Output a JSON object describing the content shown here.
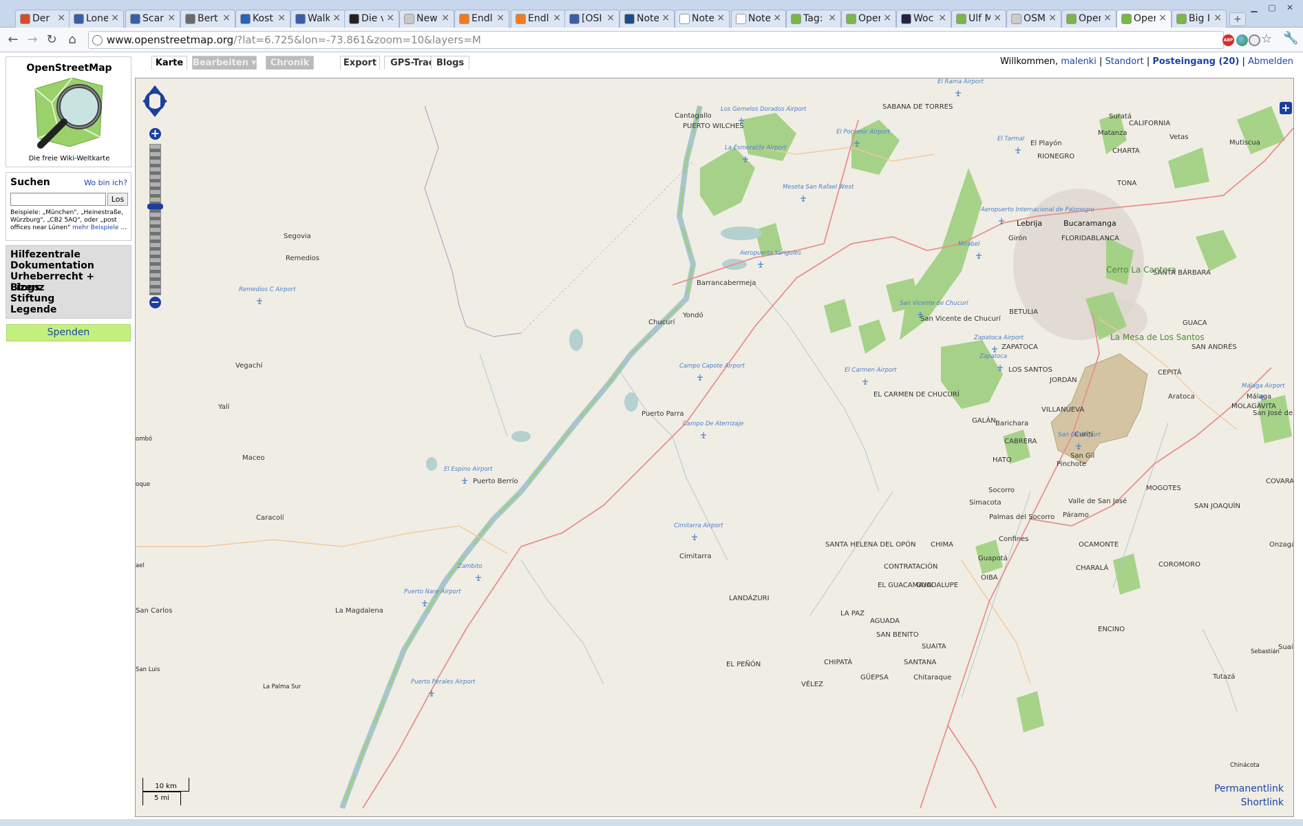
{
  "browser": {
    "tabs": [
      {
        "title": "Der",
        "fav": "#d94a2a"
      },
      {
        "title": "Lone",
        "fav": "#3b5ea8"
      },
      {
        "title": "Scar",
        "fav": "#3b5ea8"
      },
      {
        "title": "Bert",
        "fav": "#6b6b6b"
      },
      {
        "title": "Kost",
        "fav": "#2a62b8"
      },
      {
        "title": "Walk",
        "fav": "#3b5ea8"
      },
      {
        "title": "Die v",
        "fav": "#222222"
      },
      {
        "title": "New",
        "fav": "#c8c8c8"
      },
      {
        "title": "Endl",
        "fav": "#f37b1d"
      },
      {
        "title": "Endl",
        "fav": "#f37b1d"
      },
      {
        "title": "[OSI",
        "fav": "#3b5ea8"
      },
      {
        "title": "Note",
        "fav": "#1b4d8c"
      },
      {
        "title": "Note",
        "fav": "#ffffff"
      },
      {
        "title": "Note",
        "fav": "#ffffff"
      },
      {
        "title": "Tag:",
        "fav": "#7ab648"
      },
      {
        "title": "Oper",
        "fav": "#7ab648"
      },
      {
        "title": "Woc",
        "fav": "#222244"
      },
      {
        "title": "Ulf M",
        "fav": "#7ab648"
      },
      {
        "title": "OSM",
        "fav": "#cccccc"
      },
      {
        "title": "Oper",
        "fav": "#7ab648"
      },
      {
        "title": "Oper",
        "fav": "#7ab648"
      },
      {
        "title": "Big I",
        "fav": "#7ab648"
      }
    ],
    "active_tab": 20,
    "url_host": "www.openstreetmap.org",
    "url_rest": "/?lat=6.725&lon=-73.861&zoom=10&layers=M",
    "ext_abp": "ABP"
  },
  "sidebar": {
    "logo_title": "OpenStreetMap",
    "logo_subtitle": "Die freie Wiki-Weltkarte",
    "search_title": "Suchen",
    "where_am_i": "Wo bin ich?",
    "search_value": "",
    "search_button": "Los",
    "search_hint": "Beispiele: „München\", „Heinestraße, Würzburg\", „CB2 5AQ\", oder „post offices near Lünen\"",
    "search_more": "mehr Beispiele",
    "search_ellipsis": "…",
    "menu": [
      "Hilfezentrale",
      "Dokumentation",
      "Urheberrecht + Lizenz",
      "Blogs",
      "Stiftung",
      "Legende"
    ],
    "donate": "Spenden"
  },
  "page_tabs": [
    "Karte",
    "Bearbeiten ▾",
    "Chronik",
    "Export",
    "GPS-Tracks",
    "Blogs"
  ],
  "userbar": {
    "welcome": "Willkommen, ",
    "user": "malenki",
    "sep1": " | ",
    "location": "Standort",
    "sep2": " | ",
    "inbox": "Posteingang (20)",
    "sep3": " | ",
    "logout": "Abmelden"
  },
  "map": {
    "permalink": "Permanentlink",
    "shortlink": "Shortlink",
    "scale_km": "10 km",
    "scale_mi": "5 mi",
    "colors": {
      "water": "#b5d0d0",
      "forest": "#9ecf7e",
      "road": "#e8908a",
      "border": "#b9a6c2",
      "secondary": "#f3c998"
    },
    "places": [
      {
        "name": "Cantagallo",
        "cls": "med"
      },
      {
        "name": "PUERTO WILCHES",
        "cls": "med"
      },
      {
        "name": "SABANA DE TORRES",
        "cls": "med"
      },
      {
        "name": "Barrancabermeja",
        "cls": "med"
      },
      {
        "name": "Yondó",
        "cls": "med"
      },
      {
        "name": "Segovia",
        "cls": "med"
      },
      {
        "name": "Remedios",
        "cls": "med"
      },
      {
        "name": "Chucurí",
        "cls": "med"
      },
      {
        "name": "Vegachí",
        "cls": "med"
      },
      {
        "name": "Yalí",
        "cls": "med"
      },
      {
        "name": "Maceo",
        "cls": "med"
      },
      {
        "name": "Puerto Berrío",
        "cls": "med"
      },
      {
        "name": "Caracolí",
        "cls": "med"
      },
      {
        "name": "Puerto Parra",
        "cls": "med"
      },
      {
        "name": "Cimitarra",
        "cls": "med"
      },
      {
        "name": "La Magdalena",
        "cls": "med"
      },
      {
        "name": "San Carlos",
        "cls": "med"
      },
      {
        "name": "LANDÁZURI",
        "cls": "med"
      },
      {
        "name": "EL PEÑÓN",
        "cls": "med"
      },
      {
        "name": "SANTA HELENA DEL OPÓN",
        "cls": "med"
      },
      {
        "name": "EL CARMEN DE CHUCURÍ",
        "cls": "med"
      },
      {
        "name": "San Vicente de Chucurí",
        "cls": "med"
      },
      {
        "name": "Bucaramanga",
        "cls": "big"
      },
      {
        "name": "Lebrija",
        "cls": "big"
      },
      {
        "name": "FLORIDABLANCA",
        "cls": "med"
      },
      {
        "name": "Girón",
        "cls": "med"
      },
      {
        "name": "RIONEGRO",
        "cls": "med"
      },
      {
        "name": "El Playón",
        "cls": "med"
      },
      {
        "name": "Matanza",
        "cls": "med"
      },
      {
        "name": "Suratá",
        "cls": "med"
      },
      {
        "name": "CALIFORNIA",
        "cls": "med"
      },
      {
        "name": "Vetas",
        "cls": "med"
      },
      {
        "name": "CHARTA",
        "cls": "med"
      },
      {
        "name": "TONA",
        "cls": "med"
      },
      {
        "name": "Mutiscua",
        "cls": "med"
      },
      {
        "name": "SANTA BÁRBARA",
        "cls": "med"
      },
      {
        "name": "BETULIA",
        "cls": "med"
      },
      {
        "name": "ZAPATOCA",
        "cls": "med"
      },
      {
        "name": "LOS SANTOS",
        "cls": "med"
      },
      {
        "name": "JORDÁN",
        "cls": "med"
      },
      {
        "name": "CEPITÁ",
        "cls": "med"
      },
      {
        "name": "GUACA",
        "cls": "med"
      },
      {
        "name": "SAN ANDRÉS",
        "cls": "med"
      },
      {
        "name": "Aratoca",
        "cls": "med"
      },
      {
        "name": "VILLANUEVA",
        "cls": "med"
      },
      {
        "name": "Barichara",
        "cls": "med"
      },
      {
        "name": "GALÁN",
        "cls": "med"
      },
      {
        "name": "CABRERA",
        "cls": "med"
      },
      {
        "name": "San Gil",
        "cls": "med"
      },
      {
        "name": "Curití",
        "cls": "med"
      },
      {
        "name": "Pinchote",
        "cls": "med"
      },
      {
        "name": "HATO",
        "cls": "med"
      },
      {
        "name": "Socorro",
        "cls": "med"
      },
      {
        "name": "Simacota",
        "cls": "med"
      },
      {
        "name": "Palmas del Socorro",
        "cls": "med"
      },
      {
        "name": "Páramo",
        "cls": "med"
      },
      {
        "name": "Valle de San José",
        "cls": "med"
      },
      {
        "name": "MOGOTES",
        "cls": "med"
      },
      {
        "name": "SAN JOAQUÍN",
        "cls": "med"
      },
      {
        "name": "MOLAGAVITA",
        "cls": "med"
      },
      {
        "name": "Málaga",
        "cls": "med"
      },
      {
        "name": "San José de Miranda",
        "cls": "med"
      },
      {
        "name": "COVARACHÍA",
        "cls": "med"
      },
      {
        "name": "Onzaga",
        "cls": "med"
      },
      {
        "name": "OCAMONTE",
        "cls": "med"
      },
      {
        "name": "CHIMA",
        "cls": "med"
      },
      {
        "name": "Confines",
        "cls": "med"
      },
      {
        "name": "Guapotá",
        "cls": "med"
      },
      {
        "name": "OIBA",
        "cls": "med"
      },
      {
        "name": "CHARALÁ",
        "cls": "med"
      },
      {
        "name": "COROMORO",
        "cls": "med"
      },
      {
        "name": "CONTRATACIÓN",
        "cls": "med"
      },
      {
        "name": "EL GUACAMAYO",
        "cls": "med"
      },
      {
        "name": "GUADALUPE",
        "cls": "med"
      },
      {
        "name": "LA PAZ",
        "cls": "med"
      },
      {
        "name": "AGUADA",
        "cls": "med"
      },
      {
        "name": "SAN BENITO",
        "cls": "med"
      },
      {
        "name": "SUAITA",
        "cls": "med"
      },
      {
        "name": "SANTANA",
        "cls": "med"
      },
      {
        "name": "CHIPATÁ",
        "cls": "med"
      },
      {
        "name": "VÉLEZ",
        "cls": "med"
      },
      {
        "name": "GÜEPSA",
        "cls": "med"
      },
      {
        "name": "Chitaraque",
        "cls": "med"
      },
      {
        "name": "ENCINO",
        "cls": "med"
      },
      {
        "name": "Tutazá",
        "cls": "med"
      },
      {
        "name": "Suaita",
        "cls": "med"
      }
    ],
    "airports": [
      "Los Gemelos Dorados Airport",
      "El Porvenir Airport",
      "La Esmeralda Airport",
      "Meseta San Rafael West",
      "Aeropuerto Yariguíes",
      "Aeropuerto Internacional de Palonegro",
      "El Tarmal",
      "El Rama Airport",
      "Remedios C Airport",
      "San Vicente de Chucurí",
      "Zapatoca Airport",
      "Zapatoca",
      "El Carmen Airport",
      "Campo Capote Airport",
      "Campo De Aterrizaje",
      "El Espino Airport",
      "Cimitarra Airport",
      "Zambito",
      "Puerto Nare Airport",
      "Puerto Perales Airport",
      "San Gil Airport",
      "Málaga Airport",
      "Mirabel"
    ],
    "parks": [
      "Cerro La Cantera",
      "La Mesa de Los Santos"
    ],
    "edge_labels": [
      "ombó",
      "oque",
      "ael",
      "San Luis",
      "La Palma Sur",
      "Sebastián",
      "Chinácota"
    ]
  }
}
